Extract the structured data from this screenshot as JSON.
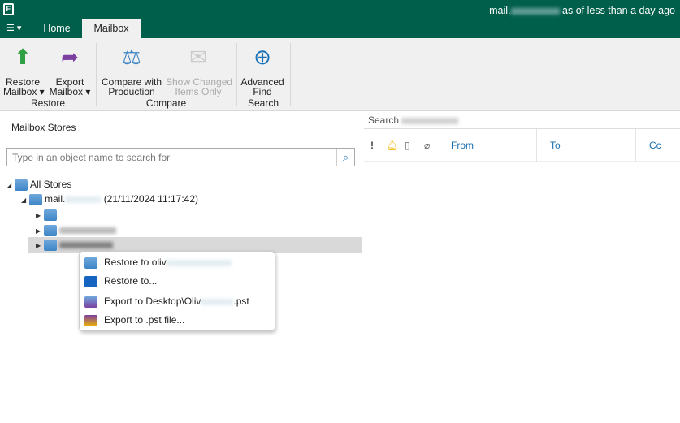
{
  "titlebar": {
    "connection_prefix": "mail.",
    "connection_suffix": "as of less than a day ago"
  },
  "tabs": [
    {
      "label": "Home"
    },
    {
      "label": "Mailbox"
    }
  ],
  "ribbon": {
    "restore_mailbox": "Restore\nMailbox ▾",
    "export_mailbox": "Export\nMailbox ▾",
    "compare": "Compare with\nProduction",
    "show_changed": "Show Changed\nItems Only",
    "advanced_find": "Advanced\nFind",
    "groups": [
      "Restore",
      "Compare",
      "Search"
    ]
  },
  "left": {
    "title": "Mailbox Stores",
    "search_placeholder": "Type in an object name to search for",
    "tree": {
      "root": "All Stores",
      "server_prefix": "mail.",
      "server_date": "(21/11/2024 11:17:42)"
    }
  },
  "context_menu": [
    "Restore to oliv",
    "Restore to...",
    "Export to Desktop\\Oliv",
    "Export to .pst file..."
  ],
  "context_menu_suffix": ".pst",
  "right": {
    "search_label": "Search",
    "columns": [
      "From",
      "To",
      "Cc"
    ]
  },
  "colors": {
    "brand": "#005f4b",
    "link": "#1a6fb0"
  }
}
